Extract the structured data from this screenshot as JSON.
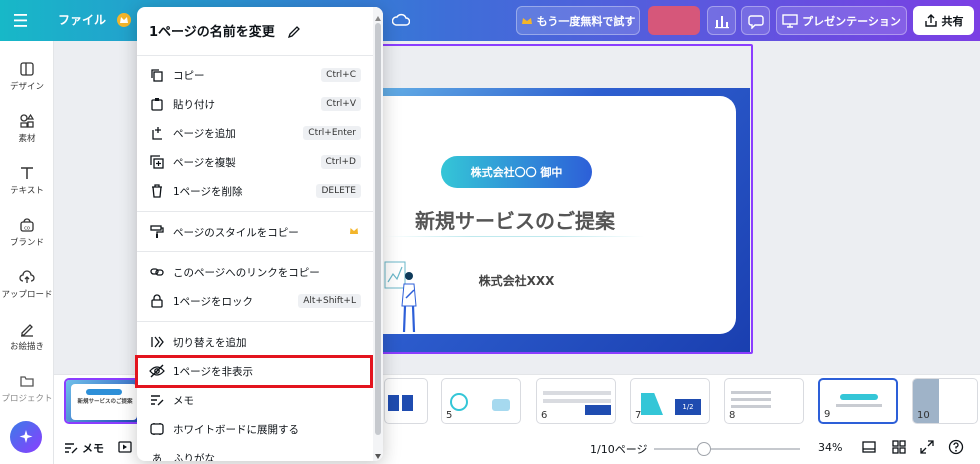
{
  "topbar": {
    "file_label": "ファイル",
    "trial_label": "もう一度無料で試す",
    "present_label": "プレゼンテーション",
    "share_label": "共有"
  },
  "sidebar": {
    "items": [
      {
        "label": "デザイン",
        "icon": "layout-icon"
      },
      {
        "label": "素材",
        "icon": "shapes-icon"
      },
      {
        "label": "テキスト",
        "icon": "text-icon"
      },
      {
        "label": "ブランド",
        "icon": "brand-icon"
      },
      {
        "label": "アップロード",
        "icon": "upload-cloud-icon"
      },
      {
        "label": "お絵描き",
        "icon": "draw-icon"
      },
      {
        "label": "プロジェクト",
        "icon": "folder-icon"
      }
    ]
  },
  "context_menu": {
    "title": "1ページの名前を変更",
    "items": [
      {
        "label": "コピー",
        "shortcut": "Ctrl+C",
        "icon": "copy-icon"
      },
      {
        "label": "貼り付け",
        "shortcut": "Ctrl+V",
        "icon": "paste-icon"
      },
      {
        "label": "ページを追加",
        "shortcut": "Ctrl+Enter",
        "icon": "add-page-icon"
      },
      {
        "label": "ページを複製",
        "shortcut": "Ctrl+D",
        "icon": "duplicate-icon"
      },
      {
        "label": "1ページを削除",
        "shortcut": "DELETE",
        "icon": "trash-icon"
      },
      {
        "label": "ページのスタイルをコピー",
        "shortcut": "",
        "icon": "paint-roller-icon"
      },
      {
        "label": "このページへのリンクをコピー",
        "shortcut": "",
        "icon": "link-icon"
      },
      {
        "label": "1ページをロック",
        "shortcut": "Alt+Shift+L",
        "icon": "lock-icon"
      },
      {
        "label": "切り替えを追加",
        "shortcut": "",
        "icon": "transition-icon"
      },
      {
        "label": "1ページを非表示",
        "shortcut": "",
        "icon": "eye-off-icon"
      },
      {
        "label": "メモ",
        "shortcut": "",
        "icon": "notes-icon"
      },
      {
        "label": "ホワイトボードに展開する",
        "shortcut": "",
        "icon": "whiteboard-icon"
      },
      {
        "label": "ふりがな",
        "shortcut": "",
        "icon": "furigana-icon"
      }
    ]
  },
  "slide": {
    "pill": "株式会社〇〇 御中",
    "title": "新規サービスのご提案",
    "company": "株式会社XXX"
  },
  "thumbnails": {
    "numbers": [
      "5",
      "6",
      "7",
      "8",
      "9",
      "10"
    ],
    "thumb1_title": "新規サービスのご提案",
    "thumb7_fraction": "1/2"
  },
  "statusbar": {
    "notes_label": "メモ",
    "page_indicator": "1/10ページ",
    "zoom": "34%",
    "zoom_level": 0.34
  },
  "colors": {
    "accent_purple": "#8b3dff",
    "highlight_red": "#e3141e",
    "brand_blue": "#2e5fd0",
    "brand_cyan": "#34c6d7"
  }
}
